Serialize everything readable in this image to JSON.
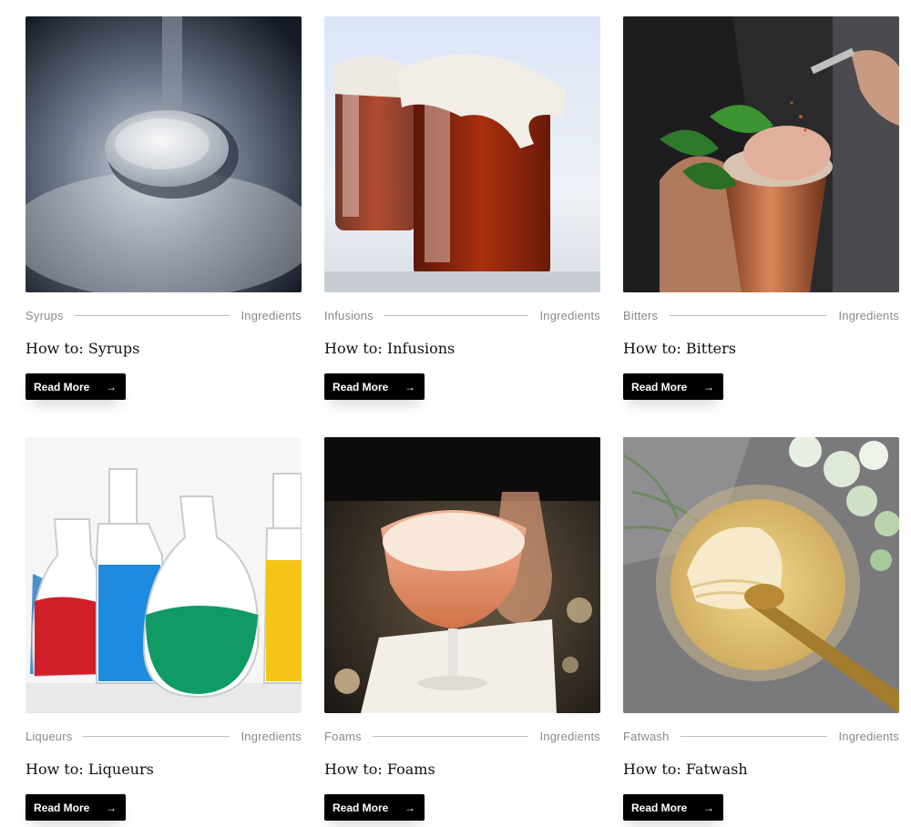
{
  "cards": [
    {
      "category": "Syrups",
      "tag": "Ingredients",
      "title": "How to: Syrups",
      "button": "Read More",
      "image": "sugar-spoon-photo",
      "arrow_icon": "→"
    },
    {
      "category": "Infusions",
      "tag": "Ingredients",
      "title": "How to: Infusions",
      "button": "Read More",
      "image": "infusion-jars-photo",
      "arrow_icon": "→"
    },
    {
      "category": "Bitters",
      "tag": "Ingredients",
      "title": "How to: Bitters",
      "button": "Read More",
      "image": "copper-cup-cocktail-photo",
      "arrow_icon": "→"
    },
    {
      "category": "Liqueurs",
      "tag": "Ingredients",
      "title": "How to: Liqueurs",
      "button": "Read More",
      "image": "colored-bottles-photo",
      "arrow_icon": "→"
    },
    {
      "category": "Foams",
      "tag": "Ingredients",
      "title": "How to: Foams",
      "button": "Read More",
      "image": "foam-cocktail-photo",
      "arrow_icon": "→"
    },
    {
      "category": "Fatwash",
      "tag": "Ingredients",
      "title": "How to: Fatwash",
      "button": "Read More",
      "image": "butter-jar-photo",
      "arrow_icon": "→"
    }
  ],
  "colors": {
    "button_bg": "#000000",
    "meta_text": "#8a8a8a",
    "divider": "#bdbdbd"
  }
}
